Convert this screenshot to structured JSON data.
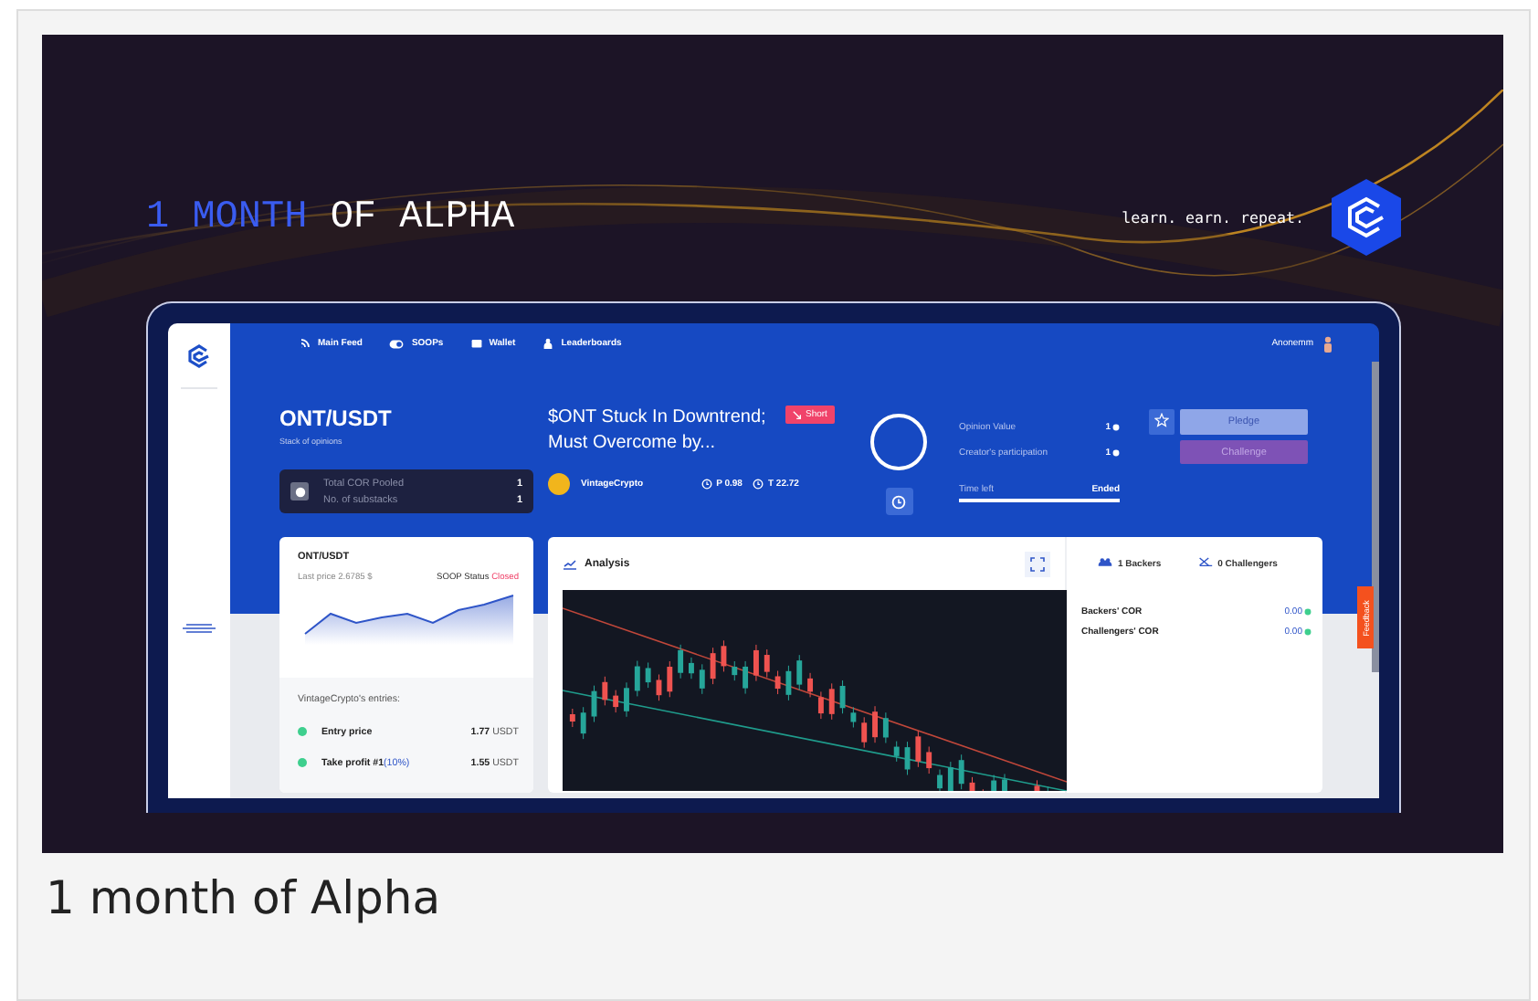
{
  "banner": {
    "headline_accent": "1 MONTH",
    "headline_rest": "OF ALPHA",
    "tagline": "learn. earn. repeat."
  },
  "app": {
    "nav": [
      {
        "label": "Main Feed"
      },
      {
        "label": "SOOPs"
      },
      {
        "label": "Wallet"
      },
      {
        "label": "Leaderboards"
      }
    ],
    "user": "Anonemm",
    "pair": "ONT/USDT",
    "pair_subtitle": "Stack of opinions",
    "pool": {
      "label": "Total COR Pooled",
      "value": "1",
      "sub_label": "No. of substacks",
      "sub_value": "1"
    },
    "opinion": {
      "title": "$ONT Stuck In Downtrend; Must Overcome by...",
      "badge": "Short",
      "author": "VintageCrypto",
      "p": "P 0.98",
      "t": "T 22.72"
    },
    "stats": [
      {
        "label": "Opinion Value",
        "value": "1"
      },
      {
        "label": "Creator's participation",
        "value": "1"
      }
    ],
    "time": {
      "label": "Time left",
      "value": "Ended",
      "level": 1
    },
    "buttons": [
      {
        "label": "Pledge",
        "kind": "pledge"
      },
      {
        "label": "Challenge",
        "kind": "challenge"
      }
    ],
    "price_card": {
      "pair": "ONT/USDT",
      "last_price": "Last price 2.6785 $",
      "status_label": "SOOP Status",
      "status": "Closed"
    },
    "entries_title": "VintageCrypto's entries:",
    "entries": [
      {
        "label": "Entry price",
        "value": "1.77",
        "unit": "USDT"
      },
      {
        "label": "Take profit #1",
        "note": "(10%)",
        "value": "1.55",
        "unit": "USDT"
      }
    ],
    "analysis_title": "Analysis",
    "backers": {
      "backers": "1 Backers",
      "challengers": "0 Challengers"
    },
    "cor_rows": [
      {
        "label": "Backers' COR",
        "value": "0.00"
      },
      {
        "label": "Challengers' COR",
        "value": "0.00"
      }
    ],
    "feedback": "Feedback"
  },
  "caption": "1 month of Alpha"
}
